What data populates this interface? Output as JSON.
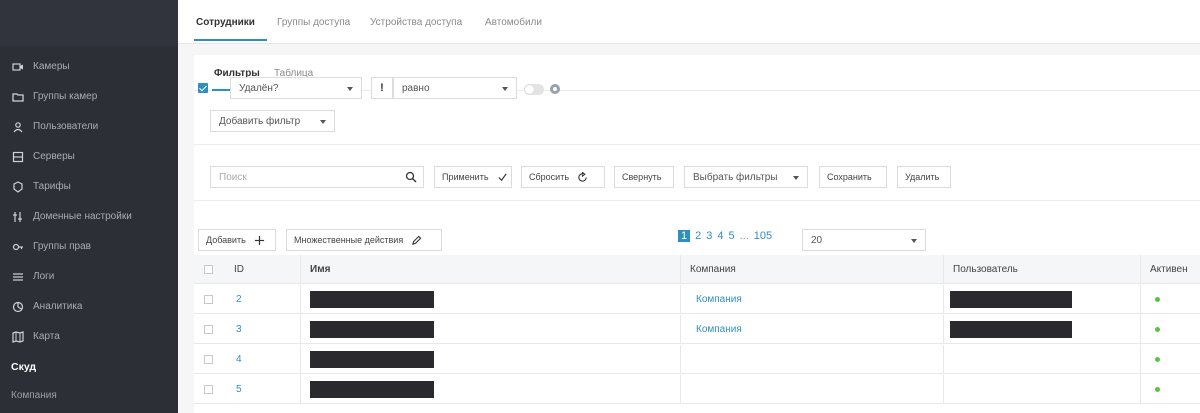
{
  "sidebar": {
    "items": [
      {
        "label": "Камеры",
        "icon": "camera-icon"
      },
      {
        "label": "Группы камер",
        "icon": "folder-icon"
      },
      {
        "label": "Пользователи",
        "icon": "user-icon"
      },
      {
        "label": "Серверы",
        "icon": "server-icon"
      },
      {
        "label": "Тарифы",
        "icon": "tag-icon"
      },
      {
        "label": "Доменные настройки",
        "icon": "sliders-icon"
      },
      {
        "label": "Группы прав",
        "icon": "key-icon"
      },
      {
        "label": "Логи",
        "icon": "list-icon"
      },
      {
        "label": "Аналитика",
        "icon": "analytics-icon"
      },
      {
        "label": "Карта",
        "icon": "map-icon"
      }
    ],
    "section": "Скуд",
    "subitem": "Компания"
  },
  "top_tabs": [
    "Сотрудники",
    "Группы доступа",
    "Устройства доступа",
    "Автомобили"
  ],
  "sub_tabs": [
    "Фильтры",
    "Таблица"
  ],
  "filter": {
    "field": "Удалён?",
    "negate": "!",
    "operator": "равно",
    "add_filter": "Добавить фильтр"
  },
  "toolbar": {
    "search_placeholder": "Поиск",
    "apply": "Применить",
    "reset": "Сбросить",
    "collapse": "Свернуть",
    "choose_filters": "Выбрать фильтры",
    "save": "Сохранить",
    "delete": "Удалить",
    "add": "Добавить",
    "bulk_actions": "Множественные действия"
  },
  "pagination": {
    "pages": [
      "1",
      "2",
      "3",
      "4",
      "5"
    ],
    "ellipsis": "...",
    "last": "105",
    "per_page": "20"
  },
  "table": {
    "columns": {
      "id": "ID",
      "name": "Имя",
      "company": "Компания",
      "user": "Пользователь",
      "active": "Активен"
    },
    "rows": [
      {
        "id": "2",
        "company": "Компания"
      },
      {
        "id": "3",
        "company": "Компания"
      },
      {
        "id": "4",
        "company": ""
      },
      {
        "id": "5",
        "company": ""
      }
    ]
  },
  "colors": {
    "accent": "#2f8fc0",
    "sidebar": "#2c2f36",
    "active_dot": "#5cc04a"
  }
}
